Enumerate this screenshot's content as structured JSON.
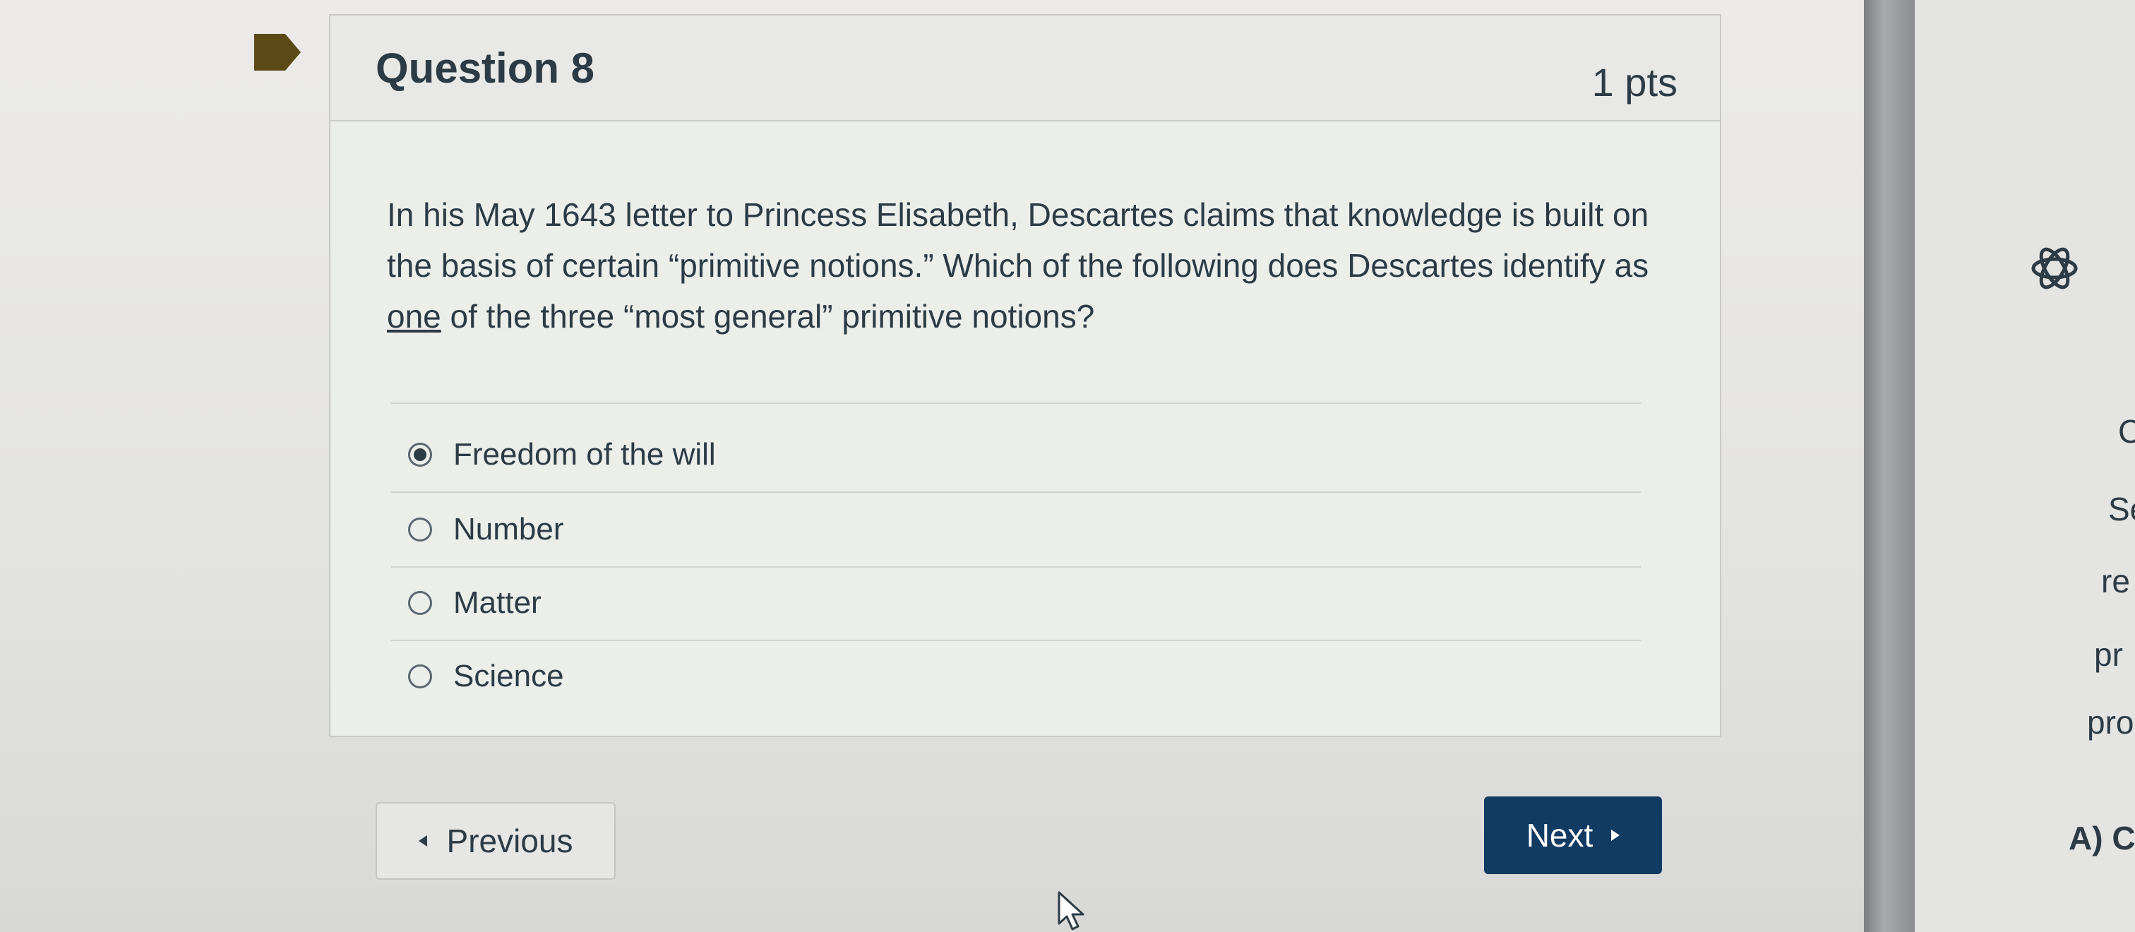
{
  "question": {
    "title": "Question 8",
    "points": "1 pts",
    "text_before_underline": "In his May 1643 letter to Princess Elisabeth, Descartes claims that knowledge is built on the basis of certain “primitive notions.” Which of the following does Descartes identify as ",
    "text_underlined": "one",
    "text_after_underline": " of the three “most general” primitive notions?",
    "answers": [
      {
        "label": "Freedom of the will",
        "selected": true
      },
      {
        "label": "Number",
        "selected": false
      },
      {
        "label": "Matter",
        "selected": false
      },
      {
        "label": "Science",
        "selected": false
      }
    ]
  },
  "navigation": {
    "previous_label": "Previous",
    "next_label": "Next"
  },
  "side_panel": {
    "fragments": [
      "C",
      "Se",
      "re",
      "pr",
      "pro",
      "A) C"
    ]
  },
  "colors": {
    "text": "#2d3b45",
    "next_button": "#123b63",
    "flag": "#5b4a16"
  },
  "icons": {
    "flag": "flag-icon",
    "chatgpt": "chatgpt-icon",
    "cursor": "mouse-pointer-icon"
  }
}
